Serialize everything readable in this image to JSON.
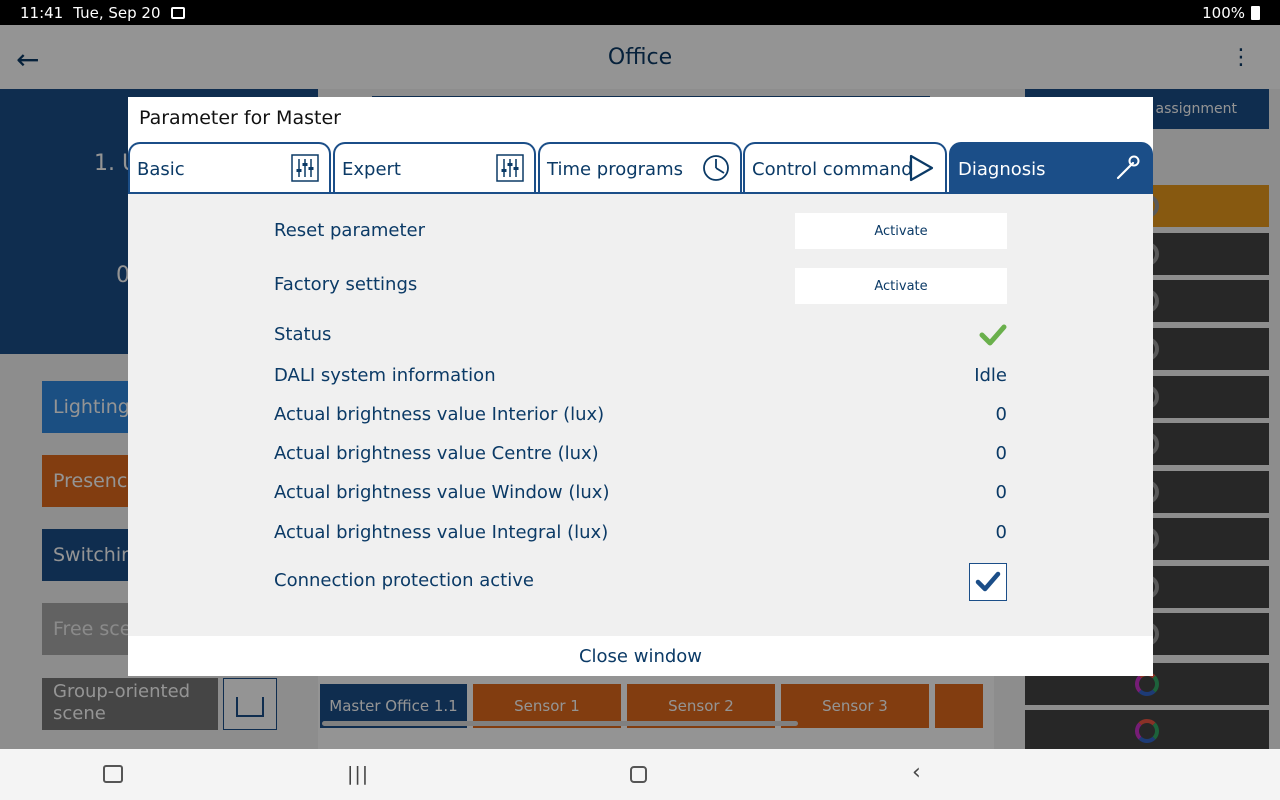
{
  "status_bar": {
    "time": "11:41",
    "date": "Tue, Sep 20",
    "battery": "100%"
  },
  "app_bar": {
    "title": "Office"
  },
  "background": {
    "card_line1": "1. U",
    "card_line2": "0",
    "right_header": "p assignment",
    "buttons": [
      "Lighting",
      "Presence",
      "Switching",
      "Free scene"
    ],
    "group_scene": "Group-oriented scene",
    "device_tabs": [
      "Master Office 1.1",
      "Sensor 1",
      "Sensor 2",
      "Sensor 3"
    ]
  },
  "dialog": {
    "title": "Parameter for Master",
    "tabs": [
      {
        "label": "Basic",
        "icon": "sliders-icon"
      },
      {
        "label": "Expert",
        "icon": "sliders-icon"
      },
      {
        "label": "Time programs",
        "icon": "clock-icon"
      },
      {
        "label": "Control command",
        "icon": "play-icon"
      },
      {
        "label": "Diagnosis",
        "icon": "wrench-icon"
      }
    ],
    "active_tab": "Diagnosis",
    "reset_parameter": {
      "label": "Reset parameter",
      "button": "Activate"
    },
    "factory_settings": {
      "label": "Factory settings",
      "button": "Activate"
    },
    "status": {
      "label": "Status",
      "state": "ok"
    },
    "dali_info": {
      "label": "DALI system information",
      "value": "Idle"
    },
    "brightness_interior": {
      "label": "Actual brightness value Interior (lux)",
      "value": "0"
    },
    "brightness_centre": {
      "label": "Actual brightness value Centre (lux)",
      "value": "0"
    },
    "brightness_window": {
      "label": "Actual brightness value Window (lux)",
      "value": "0"
    },
    "brightness_integral": {
      "label": "Actual brightness value Integral (lux)",
      "value": "0"
    },
    "connection_protection": {
      "label": "Connection protection active",
      "checked": true
    },
    "close_label": "Close window"
  },
  "colors": {
    "primary": "#1b4e88",
    "accent_orange": "#e06a1c",
    "ok_green": "#6ab04c"
  }
}
